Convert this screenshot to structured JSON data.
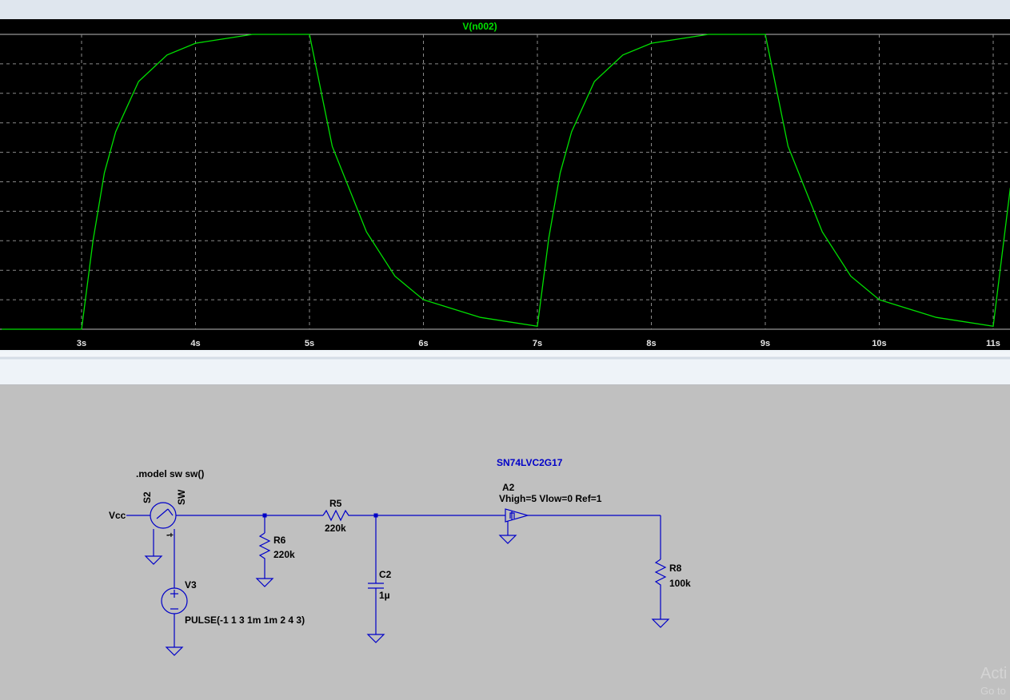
{
  "plot": {
    "trace_label": "V(n002)",
    "trace_color": "#00e000",
    "grid_color": "#8a8a8a",
    "chart_data": {
      "type": "line",
      "title": "V(n002)",
      "x_ticks": [
        "3s",
        "4s",
        "5s",
        "6s",
        "7s",
        "8s",
        "9s",
        "10s",
        "11s"
      ],
      "xlim": [
        2.3,
        11.2
      ],
      "series": [
        {
          "name": "V(n002)",
          "x": [
            2.3,
            3.0,
            3.1,
            3.2,
            3.3,
            3.5,
            3.75,
            4.0,
            4.5,
            5.0,
            5.2,
            5.5,
            5.75,
            6.0,
            6.5,
            7.0,
            7.1,
            7.2,
            7.3,
            7.5,
            7.75,
            8.0,
            8.5,
            9.0,
            9.2,
            9.5,
            9.75,
            10.0,
            10.5,
            11.0,
            11.15
          ],
          "y": [
            0.0,
            0.0,
            0.3,
            0.53,
            0.67,
            0.84,
            0.93,
            0.97,
            1.0,
            1.0,
            0.62,
            0.33,
            0.18,
            0.1,
            0.04,
            0.01,
            0.31,
            0.53,
            0.67,
            0.84,
            0.93,
            0.97,
            1.0,
            1.0,
            0.62,
            0.33,
            0.18,
            0.1,
            0.04,
            0.01,
            0.48
          ]
        }
      ]
    }
  },
  "schematic": {
    "wire_color": "#0000c8",
    "model_directive": ".model sw sw()",
    "switch_name": "S2",
    "switch_model": "SW",
    "vcc_label": "Vcc",
    "r5_name": "R5",
    "r5_value": "220k",
    "r6_name": "R6",
    "r6_value": "220k",
    "c2_name": "C2",
    "c2_value": "1µ",
    "v3_name": "V3",
    "v3_value": "PULSE(-1 1 3 1m 1m 2 4 3)",
    "a2_part": "SN74LVC2G17",
    "a2_name": "A2",
    "a2_params": "Vhigh=5 Vlow=0 Ref=1",
    "r8_name": "R8",
    "r8_value": "100k",
    "plus_sign": "+",
    "minus_sign": "-"
  },
  "watermark": {
    "line1": "Acti",
    "line2": "Go to"
  }
}
